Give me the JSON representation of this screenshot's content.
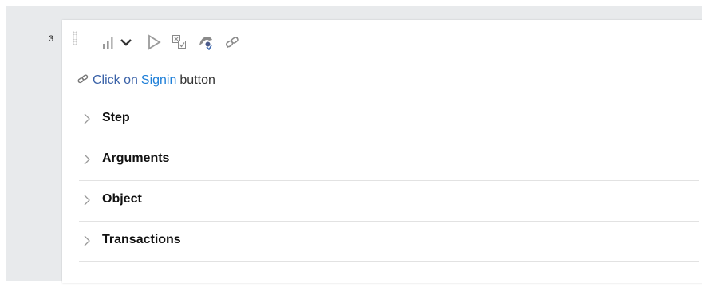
{
  "step": {
    "number": "3"
  },
  "toolbar": {
    "icons": [
      "signal-bars-icon",
      "chevron-down-icon",
      "play-icon",
      "checklist-icon",
      "spy-icon",
      "link-icon"
    ]
  },
  "description": {
    "verb": "Click on",
    "object": "Signin",
    "suffix": "button"
  },
  "sections": [
    {
      "label": "Step"
    },
    {
      "label": "Arguments"
    },
    {
      "label": "Object"
    },
    {
      "label": "Transactions"
    }
  ],
  "colors": {
    "link_blue": "#1e7fd8",
    "verb_blue": "#3a62a8",
    "icon_gray": "#9a9a9a"
  }
}
